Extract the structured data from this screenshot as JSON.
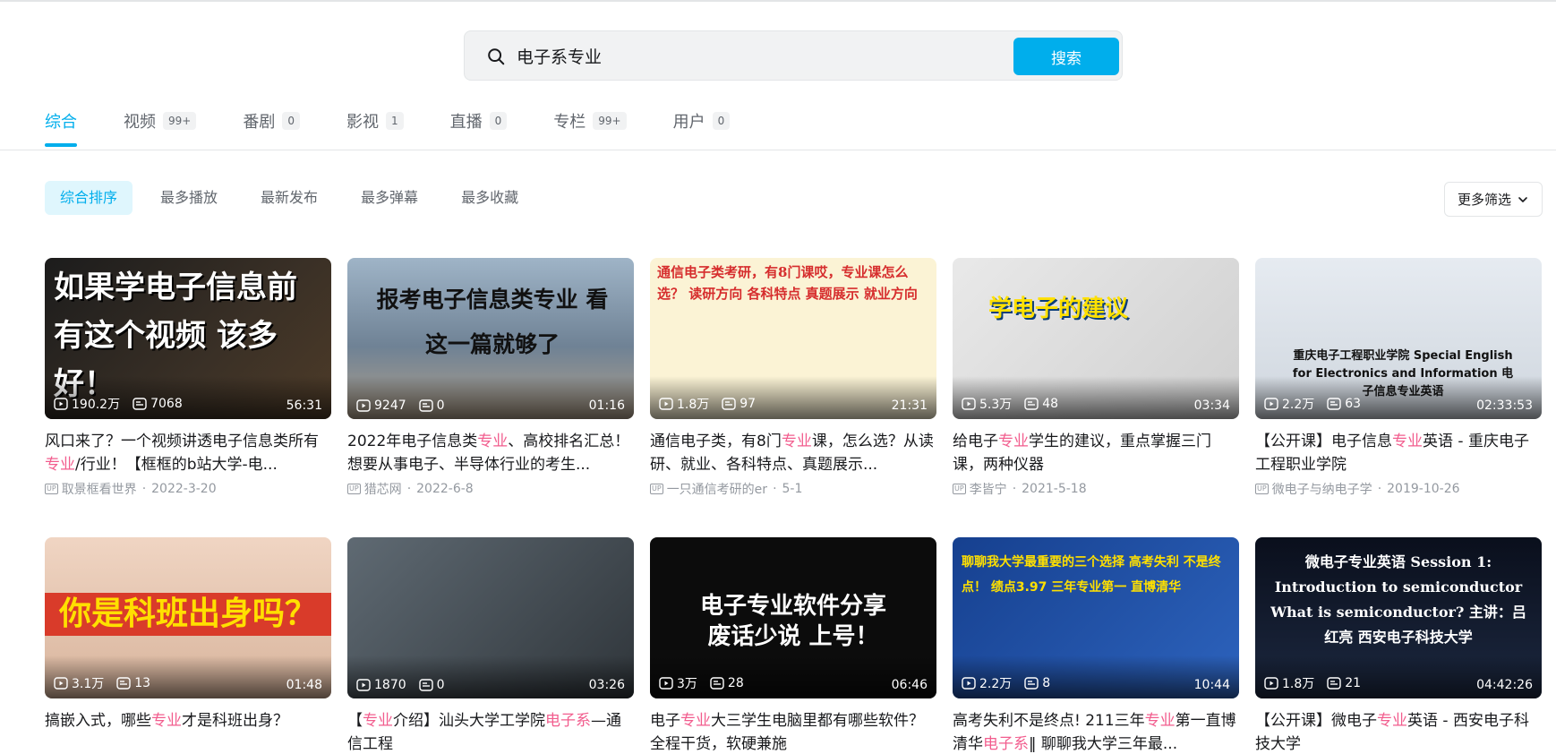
{
  "search": {
    "value": "电子系专业",
    "button_label": "搜索"
  },
  "tabs": [
    {
      "label": "综合",
      "count": "",
      "active": true
    },
    {
      "label": "视频",
      "count": "99+"
    },
    {
      "label": "番剧",
      "count": "0"
    },
    {
      "label": "影视",
      "count": "1"
    },
    {
      "label": "直播",
      "count": "0"
    },
    {
      "label": "专栏",
      "count": "99+"
    },
    {
      "label": "用户",
      "count": "0"
    }
  ],
  "sorts": [
    {
      "label": "综合排序",
      "active": true
    },
    {
      "label": "最多播放"
    },
    {
      "label": "最新发布"
    },
    {
      "label": "最多弹幕"
    },
    {
      "label": "最多收藏"
    }
  ],
  "more_filter": "更多筛选",
  "up_badge": "UP",
  "videos": [
    {
      "thumb_text": "如果学电子信息前 有这个视频 该多好！",
      "plays": "190.2万",
      "danmaku": "7068",
      "duration": "56:31",
      "title_parts": [
        "风口来了？一个视频讲透电子信息类所有",
        "专业",
        "/行业！【框框的b站大学-电..."
      ],
      "author": "取景框看世界",
      "date": "2022-3-20"
    },
    {
      "thumb_text": "报考电子信息类专业 看这一篇就够了",
      "plays": "9247",
      "danmaku": "0",
      "duration": "01:16",
      "title_parts": [
        "2022年电子信息类",
        "专业",
        "、高校排名汇总！想要从事电子、半导体行业的考生..."
      ],
      "author": "猎芯网",
      "date": "2022-6-8"
    },
    {
      "thumb_text": "通信电子类考研，有8门课哎，专业课怎么选？ 读研方向 各科特点 真题展示 就业方向",
      "plays": "1.8万",
      "danmaku": "97",
      "duration": "21:31",
      "title_parts": [
        "通信电子类，有8门",
        "专业",
        "课，怎么选？从读研、就业、各科特点、真题展示..."
      ],
      "author": "一只通信考研的er",
      "date": "5-1"
    },
    {
      "thumb_text": "学电子的建议",
      "plays": "5.3万",
      "danmaku": "48",
      "duration": "03:34",
      "title_parts": [
        "给电子",
        "专业",
        "学生的建议，重点掌握三门课，两种仪器"
      ],
      "author": "李皆宁",
      "date": "2021-5-18"
    },
    {
      "thumb_text": "重庆电子工程职业学院 Special English for Electronics and Information 电子信息专业英语",
      "plays": "2.2万",
      "danmaku": "63",
      "duration": "02:33:53",
      "title_parts": [
        "【公开课】电子信息",
        "专业",
        "英语 - 重庆电子工程职业学院"
      ],
      "author": "微电子与纳电子学",
      "date": "2019-10-26"
    },
    {
      "thumb_text": "你是科班出身吗？",
      "plays": "3.1万",
      "danmaku": "13",
      "duration": "01:48",
      "title_parts": [
        "搞嵌入式，哪些",
        "专业",
        "才是科班出身？"
      ],
      "author": "",
      "date": ""
    },
    {
      "thumb_text": "",
      "plays": "1870",
      "danmaku": "0",
      "duration": "03:26",
      "title_parts": [
        "【",
        "专业",
        "介绍】汕头大学工学院",
        "电子系",
        "—通信工程"
      ],
      "author": "",
      "date": ""
    },
    {
      "thumb_text": "电子专业软件分享 废话少说 上号！",
      "plays": "3万",
      "danmaku": "28",
      "duration": "06:46",
      "title_parts": [
        "电子",
        "专业",
        "大三学生电脑里都有哪些软件？ 全程干货，软硬兼施"
      ],
      "author": "",
      "date": ""
    },
    {
      "thumb_text": "聊聊我大学最重要的三个选择 高考失利 不是终点！ 绩点3.97 三年专业第一 直博清华",
      "plays": "2.2万",
      "danmaku": "8",
      "duration": "10:44",
      "title_parts": [
        "高考失利不是终点! 211三年",
        "专业",
        "第一直博清华",
        "电子系",
        "‖ 聊聊我大学三年最..."
      ],
      "author": "",
      "date": ""
    },
    {
      "thumb_text": "微电子专业英语 Session 1: Introduction to semiconductor What is semiconductor? 主讲：吕红亮 西安电子科技大学",
      "plays": "1.8万",
      "danmaku": "21",
      "duration": "04:42:26",
      "title_parts": [
        "【公开课】微电子",
        "专业",
        "英语 - 西安电子科技大学"
      ],
      "author": "",
      "date": ""
    }
  ]
}
